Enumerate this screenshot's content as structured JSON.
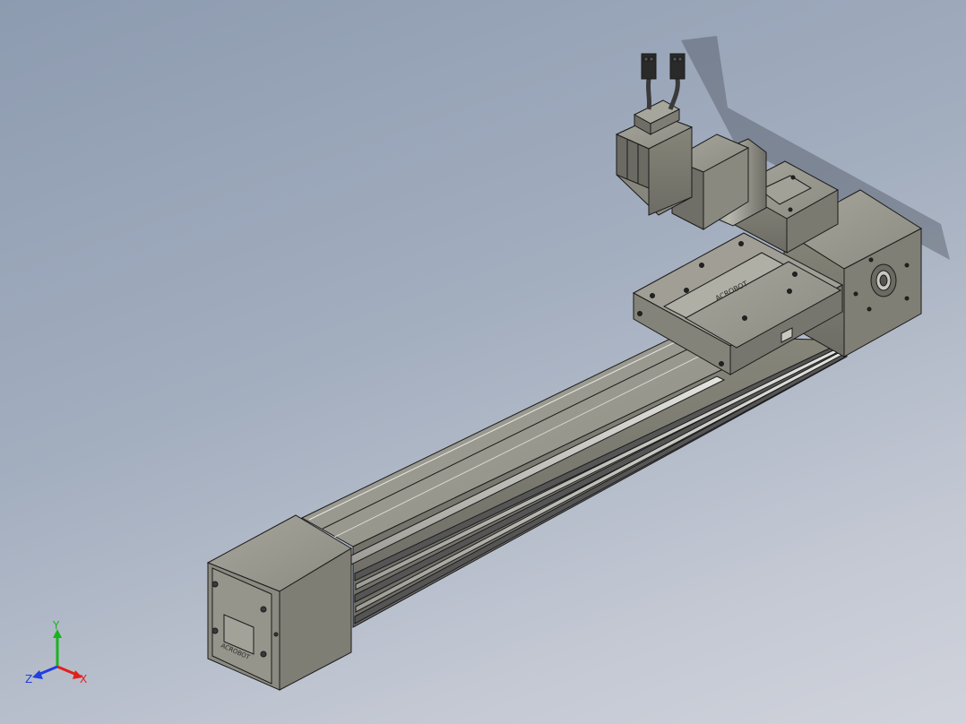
{
  "viewport": {
    "background_top": "#8d9bb0",
    "background_bottom": "#d0d3db"
  },
  "model": {
    "part_color": "#8f8e84",
    "part_light": "#a9a89d",
    "part_dark": "#6e6d66",
    "edge_color": "#1b1b1b",
    "rail_color": "#c9c9c4",
    "brand_text": "ACROBOT"
  },
  "triad": {
    "x_label": "X",
    "y_label": "Y",
    "z_label": "Z",
    "x_color": "#e0201b",
    "y_color": "#19b31e",
    "z_color": "#1f3fe0"
  }
}
